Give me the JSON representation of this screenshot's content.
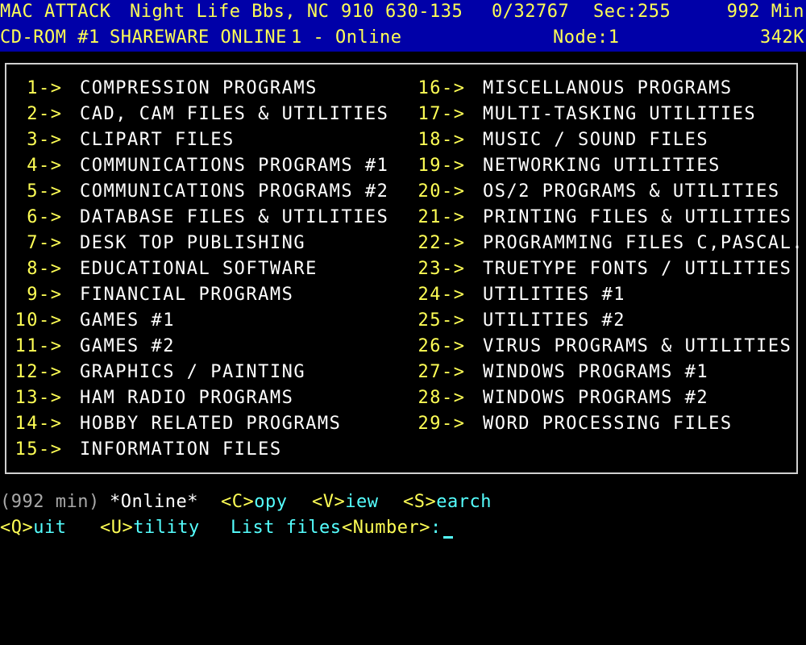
{
  "status_bar": {
    "line1": {
      "board": "MAC ATTACK",
      "bbs": "Night Life Bbs, NC",
      "phone": "910 630-135",
      "count": "0/32767",
      "security": "Sec:255",
      "minutes": "992 Min"
    },
    "line2": {
      "area": "CD-ROM #1",
      "conference": "SHAREWARE ONLINE",
      "online": "1 - Online",
      "node": "Node:1",
      "size": "342K"
    }
  },
  "menu": {
    "left": [
      {
        "num": "1",
        "label": "COMPRESSION PROGRAMS"
      },
      {
        "num": "2",
        "label": "CAD, CAM FILES & UTILITIES"
      },
      {
        "num": "3",
        "label": "CLIPART FILES"
      },
      {
        "num": "4",
        "label": "COMMUNICATIONS PROGRAMS #1"
      },
      {
        "num": "5",
        "label": "COMMUNICATIONS PROGRAMS #2"
      },
      {
        "num": "6",
        "label": "DATABASE FILES & UTILITIES"
      },
      {
        "num": "7",
        "label": "DESK TOP PUBLISHING"
      },
      {
        "num": "8",
        "label": "EDUCATIONAL SOFTWARE"
      },
      {
        "num": "9",
        "label": "FINANCIAL PROGRAMS"
      },
      {
        "num": "10",
        "label": "GAMES #1"
      },
      {
        "num": "11",
        "label": "GAMES #2"
      },
      {
        "num": "12",
        "label": "GRAPHICS / PAINTING"
      },
      {
        "num": "13",
        "label": "HAM RADIO PROGRAMS"
      },
      {
        "num": "14",
        "label": "HOBBY RELATED PROGRAMS"
      },
      {
        "num": "15",
        "label": "INFORMATION FILES"
      }
    ],
    "right": [
      {
        "num": "16",
        "label": "MISCELLANOUS PROGRAMS"
      },
      {
        "num": "17",
        "label": "MULTI-TASKING UTILITIES"
      },
      {
        "num": "18",
        "label": "MUSIC / SOUND FILES"
      },
      {
        "num": "19",
        "label": "NETWORKING UTILITIES"
      },
      {
        "num": "20",
        "label": "OS/2 PROGRAMS & UTILITIES"
      },
      {
        "num": "21",
        "label": "PRINTING FILES & UTILITIES"
      },
      {
        "num": "22",
        "label": "PROGRAMMING FILES C,PASCAL.."
      },
      {
        "num": "23",
        "label": "TRUETYPE FONTS / UTILITIES"
      },
      {
        "num": "24",
        "label": "UTILITIES #1"
      },
      {
        "num": "25",
        "label": "UTILITIES #2"
      },
      {
        "num": "26",
        "label": "VIRUS PROGRAMS & UTILITIES"
      },
      {
        "num": "27",
        "label": "WINDOWS PROGRAMS #1"
      },
      {
        "num": "28",
        "label": "WINDOWS PROGRAMS #2"
      },
      {
        "num": "29",
        "label": "WORD PROCESSING FILES"
      }
    ],
    "arrow": "->"
  },
  "prompt": {
    "time_left": "(992 min)",
    "online": "*Online*",
    "copy": {
      "key": "C",
      "rest": "opy"
    },
    "view": {
      "key": "V",
      "rest": "iew"
    },
    "search": {
      "key": "S",
      "rest": "earch"
    },
    "quit": {
      "key": "Q",
      "rest": "uit"
    },
    "utility": {
      "key": "U",
      "rest": "tility"
    },
    "list_files": "List files",
    "number_key": "Number",
    "input_value": ""
  },
  "colors": {
    "status_bg": "#0000a8",
    "highlight": "#ffff55",
    "text": "#ffffff",
    "command": "#55ffff",
    "muted": "#a8a8a8"
  }
}
